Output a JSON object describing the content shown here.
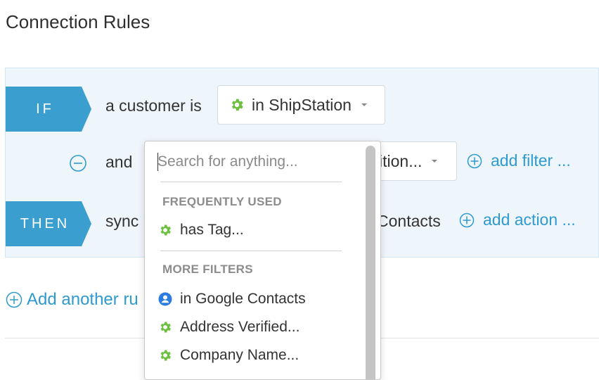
{
  "page": {
    "title": "Connection Rules"
  },
  "rules": {
    "if_label": "IF",
    "then_label": "THEN",
    "if_row": {
      "text": "a customer is",
      "dropdown_value": "in ShipStation"
    },
    "and_row": {
      "text": "and",
      "dropdown_value": "ition...",
      "add_filter": "add filter ..."
    },
    "then_row": {
      "text": "sync",
      "target_text": "Contacts",
      "add_action": "add action ..."
    },
    "add_rule": "Add another ru"
  },
  "popover": {
    "search_placeholder": "Search for anything...",
    "frequently_used_heading": "FREQUENTLY USED",
    "frequently_used": [
      {
        "label": "has Tag...",
        "icon": "gear-icon"
      }
    ],
    "more_filters_heading": "MORE FILTERS",
    "more_filters": [
      {
        "label": "in Google Contacts",
        "icon": "person-icon"
      },
      {
        "label": "Address Verified...",
        "icon": "gear-icon"
      },
      {
        "label": "Company Name...",
        "icon": "gear-icon"
      }
    ]
  },
  "colors": {
    "label_blue": "#3a9fce",
    "link_blue": "#2e9ad0",
    "gear_green": "#6cbf3f",
    "person_blue": "#2b7de0",
    "panel_bg": "#eef5fb"
  }
}
